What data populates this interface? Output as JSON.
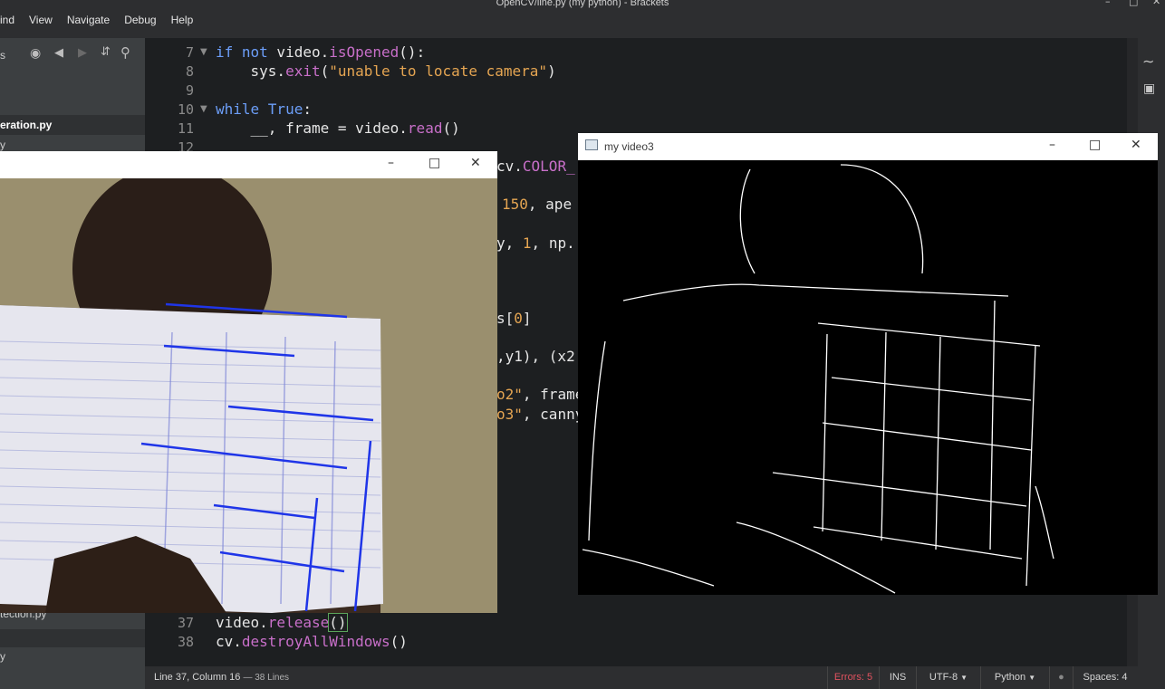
{
  "app": {
    "window_title": "OpenCV/line.py (my python) - Brackets",
    "menu": [
      "ind",
      "View",
      "Navigate",
      "Debug",
      "Help"
    ]
  },
  "sidebar": {
    "toolbar_partial": "s",
    "files": [
      {
        "label": "eration.py",
        "active": true
      },
      {
        "label": "y",
        "active": false
      },
      {
        "label": "tection.py",
        "active": false
      },
      {
        "label": "y",
        "active": false
      }
    ]
  },
  "editor": {
    "lines": [
      {
        "num": "7",
        "fold": true
      },
      {
        "num": "8",
        "fold": false
      },
      {
        "num": "9",
        "fold": false
      },
      {
        "num": "10",
        "fold": true
      },
      {
        "num": "11",
        "fold": false
      },
      {
        "num": "12",
        "fold": false
      },
      {
        "num": "37",
        "fold": false
      },
      {
        "num": "38",
        "fold": false
      }
    ],
    "code": {
      "l7_kw": "if not",
      "l7_rest": " video.",
      "l7_fn": "isOpened",
      "l7_end": "():",
      "l8_a": "    sys.",
      "l8_fn": "exit",
      "l8_str": "\"unable to locate camera\"",
      "l10_kw": "while True",
      "l11_a": "    __, frame = video.",
      "l11_fn": "read",
      "l37_a": "video.",
      "l37_fn": "release",
      "l37_b": "()",
      "l38_a": "cv.",
      "l38_fn": "destroyAllWindows",
      "l38_b": "()"
    },
    "fragments": {
      "f1a": "cv.",
      "f1b": "COLOR_",
      "f2": "150",
      "f2b": ", ape",
      "f3a": "y, ",
      "f3b": "1",
      "f3c": ", np.",
      "f4a": "s[",
      "f4b": "0",
      "f4c": "]",
      "f5": ",y1), (x2",
      "f6a": "o2\"",
      "f6b": ", frame",
      "f7a": "o3\"",
      "f7b": ", canny"
    }
  },
  "statusbar": {
    "position": "Line 37, Column 16",
    "lines": "— 38 Lines",
    "errors": "Errors: 5",
    "mode": "INS",
    "encoding": "UTF-8",
    "language": "Python",
    "spaces": "Spaces: 4"
  },
  "windows": {
    "video3_title": "my video3"
  },
  "colors": {
    "accent_error": "#e0525f",
    "keyword": "#6c9ef8",
    "string": "#e5a552",
    "function": "#c86fc9",
    "detected_lines": "#1f35e8"
  }
}
